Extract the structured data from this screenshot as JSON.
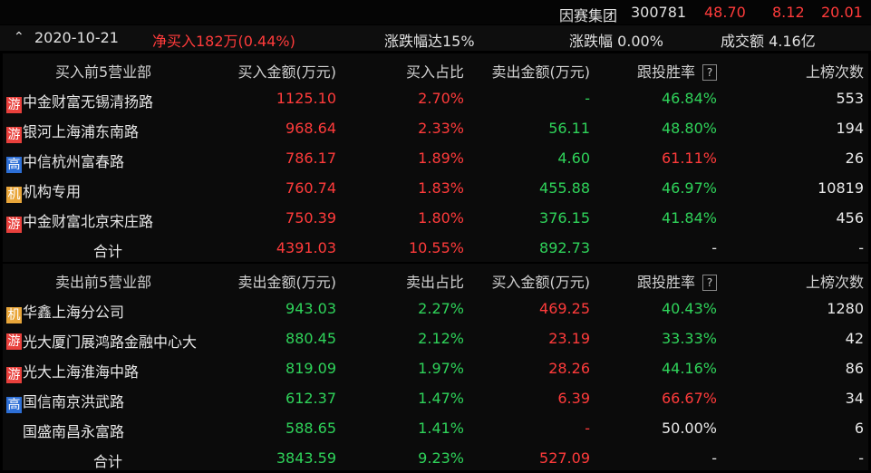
{
  "stock": {
    "name": "因赛集团",
    "code": "300781",
    "price": "48.70",
    "change": "8.12",
    "change_pct": "20.01"
  },
  "summary": {
    "collapse_icon": "^",
    "date": "2020-10-21",
    "net_buy": "净买入182万(0.44%)",
    "reason": "涨跌幅达15%",
    "change_label": "涨跌幅 0.00%",
    "turnover": "成交额 4.16亿"
  },
  "buy": {
    "headers": [
      "买入前5营业部",
      "买入金额(万元)",
      "买入占比",
      "卖出金额(万元)",
      "跟投胜率",
      "上榜次数"
    ],
    "help": "?",
    "rows": [
      {
        "tag": "游",
        "tag_type": "you",
        "name": "中金财富无锡清扬路",
        "c2": "1125.10",
        "c3": "2.70%",
        "c4": "-",
        "c5": "46.84%",
        "c6": "553"
      },
      {
        "tag": "游",
        "tag_type": "you",
        "name": "银河上海浦东南路",
        "c2": "968.64",
        "c3": "2.33%",
        "c4": "56.11",
        "c5": "48.80%",
        "c6": "194"
      },
      {
        "tag": "高",
        "tag_type": "gao",
        "name": "中信杭州富春路",
        "c2": "786.17",
        "c3": "1.89%",
        "c4": "4.60",
        "c5": "61.11%",
        "c6": "26"
      },
      {
        "tag": "机",
        "tag_type": "ji",
        "name": "机构专用",
        "c2": "760.74",
        "c3": "1.83%",
        "c4": "455.88",
        "c5": "46.97%",
        "c6": "10819"
      },
      {
        "tag": "游",
        "tag_type": "you",
        "name": "中金财富北京宋庄路",
        "c2": "750.39",
        "c3": "1.80%",
        "c4": "376.15",
        "c5": "41.84%",
        "c6": "456"
      }
    ],
    "total": {
      "name": "合计",
      "c2": "4391.03",
      "c3": "10.55%",
      "c4": "892.73",
      "c5": "-",
      "c6": "-"
    }
  },
  "sell": {
    "headers": [
      "卖出前5营业部",
      "卖出金额(万元)",
      "卖出占比",
      "买入金额(万元)",
      "跟投胜率",
      "上榜次数"
    ],
    "help": "?",
    "rows": [
      {
        "tag": "机",
        "tag_type": "ji",
        "name": "华鑫上海分公司",
        "c2": "943.03",
        "c3": "2.27%",
        "c4": "469.25",
        "c5": "40.43%",
        "c6": "1280"
      },
      {
        "tag": "游",
        "tag_type": "you",
        "name": "光大厦门展鸿路金融中心大",
        "c2": "880.45",
        "c3": "2.12%",
        "c4": "23.19",
        "c5": "33.33%",
        "c6": "42"
      },
      {
        "tag": "游",
        "tag_type": "you",
        "name": "光大上海淮海中路",
        "c2": "819.09",
        "c3": "1.97%",
        "c4": "28.26",
        "c5": "44.16%",
        "c6": "86"
      },
      {
        "tag": "高",
        "tag_type": "gao",
        "name": "国信南京洪武路",
        "c2": "612.37",
        "c3": "1.47%",
        "c4": "6.39",
        "c5": "66.67%",
        "c6": "34"
      },
      {
        "tag": "",
        "tag_type": "none",
        "name": "国盛南昌永富路",
        "c2": "588.65",
        "c3": "1.41%",
        "c4": "-",
        "c5": "50.00%",
        "c6": "6"
      }
    ],
    "total": {
      "name": "合计",
      "c2": "3843.59",
      "c3": "9.23%",
      "c4": "527.09",
      "c5": "-",
      "c6": "-"
    }
  },
  "colors": {
    "up": "#ff3b3b",
    "down": "#2fd35a",
    "background": "#000000"
  }
}
